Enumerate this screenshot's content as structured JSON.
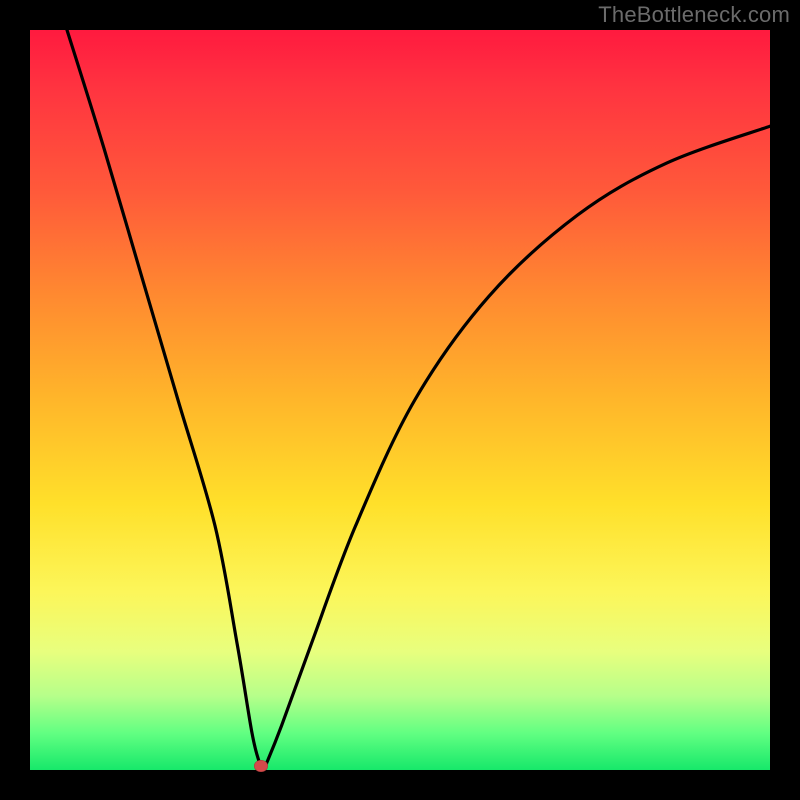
{
  "watermark": "TheBottleneck.com",
  "colors": {
    "frame": "#000000",
    "curve": "#000000",
    "marker": "#d44a4a",
    "gradient_top": "#ff1a3f",
    "gradient_bottom": "#17e86a"
  },
  "chart_data": {
    "type": "line",
    "title": "",
    "xlabel": "",
    "ylabel": "",
    "xlim": [
      0,
      100
    ],
    "ylim": [
      0,
      100
    ],
    "grid": false,
    "legend": false,
    "series": [
      {
        "name": "bottleneck-curve",
        "x": [
          5,
          10,
          15,
          20,
          25,
          28,
          30,
          31,
          31.5,
          32,
          34,
          38,
          44,
          52,
          62,
          74,
          86,
          100
        ],
        "values": [
          100,
          84,
          67,
          50,
          33,
          17,
          5,
          1,
          0,
          1,
          6,
          17,
          33,
          50,
          64,
          75,
          82,
          87
        ]
      }
    ],
    "marker": {
      "x": 31.2,
      "y": 0.5,
      "name": "min-point"
    },
    "notes": "V-shaped curve with sharp minimum near x≈31; right branch rises asymptotically toward ~87. No axis ticks or labels in source."
  }
}
